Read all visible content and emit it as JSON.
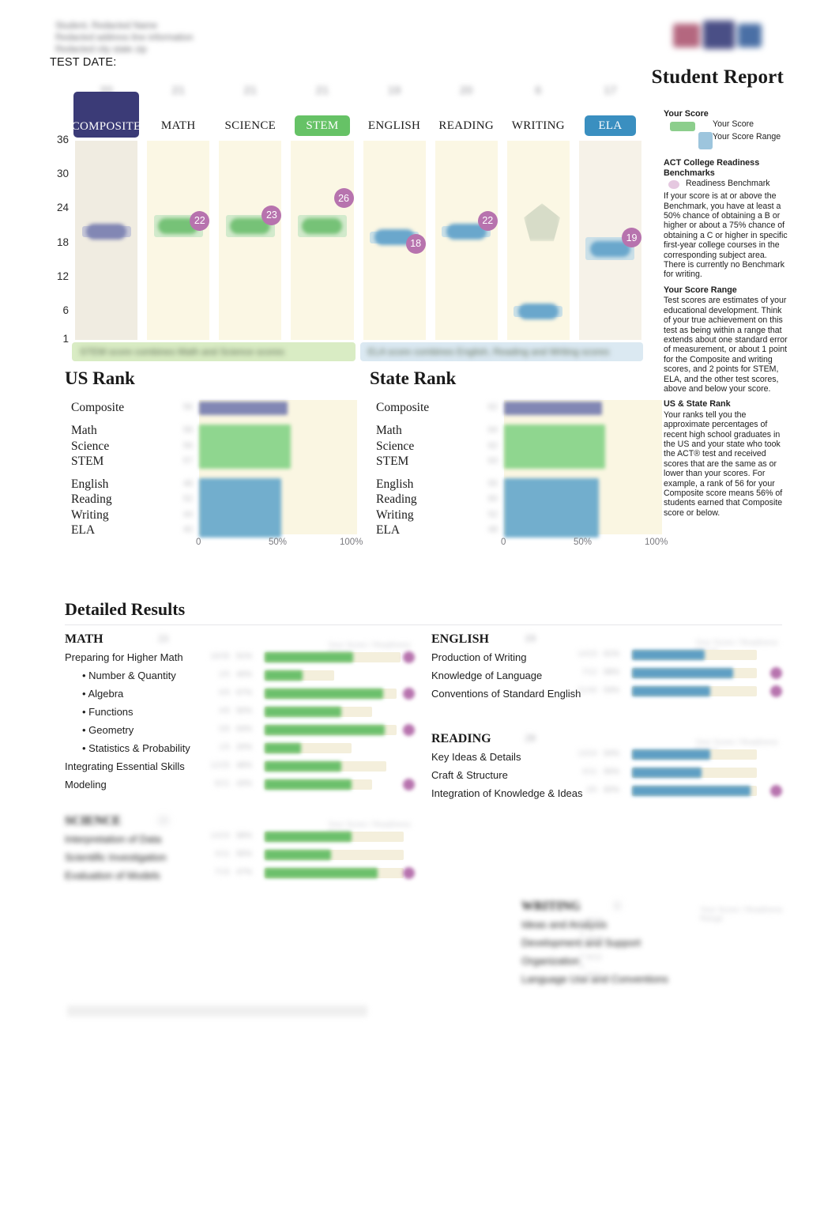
{
  "header": {
    "student_lines": [
      "Student, Redacted Name",
      "Redacted address line information",
      "Redacted city state zip"
    ],
    "test_date_label": "TEST DATE:",
    "test_date_value": "",
    "logo_alt": "ACT",
    "title": "Student Report"
  },
  "score_chart": {
    "y_ticks": [
      "36",
      "30",
      "24",
      "18",
      "12",
      "6",
      "1"
    ],
    "y_min": 1,
    "y_max": 36,
    "subjects": [
      {
        "key": "composite",
        "label": "COMPOSITE",
        "score_text": "20",
        "score": 20,
        "range_low": 19,
        "range_high": 21,
        "benchmark": null,
        "tab_style": "navy",
        "bar_color": "#8287b4",
        "band_color": "#f0ece1"
      },
      {
        "key": "math",
        "label": "MATH",
        "score_text": "21",
        "score": 21,
        "range_low": 19,
        "range_high": 23,
        "benchmark": 22,
        "tab_style": "plain",
        "bar_color": "#76c277",
        "band_color": "#fbf7e4"
      },
      {
        "key": "science",
        "label": "SCIENCE",
        "score_text": "21",
        "score": 21,
        "range_low": 19,
        "range_high": 23,
        "benchmark": 23,
        "tab_style": "plain",
        "bar_color": "#76c277",
        "band_color": "#fbf7e4"
      },
      {
        "key": "stem",
        "label": "STEM",
        "score_text": "21",
        "score": 21,
        "range_low": 19,
        "range_high": 23,
        "benchmark": 26,
        "tab_style": "green",
        "bar_color": "#76c277",
        "band_color": "#fbf7e4"
      },
      {
        "key": "english",
        "label": "ENGLISH",
        "score_text": "19",
        "score": 19,
        "range_low": 18,
        "range_high": 20,
        "benchmark": 18,
        "tab_style": "plain",
        "bar_color": "#6aa7cc",
        "band_color": "#fbf7e4"
      },
      {
        "key": "reading",
        "label": "READING",
        "score_text": "20",
        "score": 20,
        "range_low": 19,
        "range_high": 21,
        "benchmark": 22,
        "tab_style": "plain",
        "bar_color": "#6aa7cc",
        "band_color": "#fbf7e4"
      },
      {
        "key": "writing",
        "label": "WRITING",
        "score_text": "6",
        "score": 6,
        "range_low": 5,
        "range_high": 7,
        "benchmark": null,
        "tab_style": "plain",
        "bar_color": "#6aa7cc",
        "band_color": "#fbf7e4"
      },
      {
        "key": "ela",
        "label": "ELA",
        "score_text": "17",
        "score": 17,
        "range_low": 15,
        "range_high": 19,
        "benchmark": 19,
        "tab_style": "blue",
        "bar_color": "#6aa7cc",
        "band_color": "#f6f2e8"
      }
    ],
    "foot_bands": [
      {
        "key": "stem-band",
        "text": "STEM score combines Math and Science scores",
        "color": "#d9ecc4"
      },
      {
        "key": "ela-band",
        "text": "ELA score combines English, Reading and Writing scores",
        "color": "#dbe9f2"
      }
    ]
  },
  "legend": {
    "your_score_heading": "Your Score",
    "your_score_label": "Your Score",
    "your_score_range_label": "Your Score Range",
    "benchmark_heading": "ACT College Readiness Benchmarks",
    "benchmark_swatch_label": "Readiness Benchmark",
    "benchmark_body": "If your score is at or above the Benchmark, you have at least a 50% chance of obtaining a B or higher or about a 75% chance of obtaining a C or higher in specific first-year college courses in the corresponding subject area. There is currently no Benchmark for writing.",
    "range_heading": "Your Score Range",
    "range_body": "Test scores are estimates of your educational development. Think of your true achievement on this test as being within a range that extends about one standard error of measurement, or about 1 point for the Composite and writing scores, and 2 points for STEM, ELA, and the other test scores, above and below your score.",
    "rank_heading": "US & State Rank",
    "rank_body": "Your ranks tell you the approximate percentages of recent high school graduates in the US and your state who took the ACT® test and received scores that are the same as or lower than your scores. For example, a rank of 56 for your Composite score means 56% of students earned that Composite score or below."
  },
  "us_rank": {
    "title": "US Rank",
    "axis": [
      "0",
      "50%",
      "100%"
    ],
    "groups": [
      {
        "labels": [
          "Composite"
        ],
        "values": [
          "56"
        ],
        "bar_pct": 56,
        "color": "#8287b4",
        "type": "composite"
      },
      {
        "labels": [
          "Math",
          "Science",
          "STEM"
        ],
        "values": [
          "58",
          "56",
          "57"
        ],
        "bar_pct": 58,
        "color": "#8fd68f",
        "type": "stem"
      },
      {
        "labels": [
          "English",
          "Reading",
          "Writing",
          "ELA"
        ],
        "values": [
          "48",
          "52",
          "44",
          "40"
        ],
        "bar_pct": 52,
        "color": "#72aecd",
        "type": "ela"
      }
    ]
  },
  "state_rank": {
    "title": "State Rank",
    "axis": [
      "0",
      "50%",
      "100%"
    ],
    "groups": [
      {
        "labels": [
          "Composite"
        ],
        "values": [
          "62"
        ],
        "bar_pct": 62,
        "color": "#8287b4",
        "type": "composite"
      },
      {
        "labels": [
          "Math",
          "Science",
          "STEM"
        ],
        "values": [
          "64",
          "62",
          "63"
        ],
        "bar_pct": 64,
        "color": "#8fd68f",
        "type": "stem"
      },
      {
        "labels": [
          "English",
          "Reading",
          "Writing",
          "ELA"
        ],
        "values": [
          "55",
          "60",
          "52",
          "48"
        ],
        "bar_pct": 60,
        "color": "#72aecd",
        "type": "ela"
      }
    ]
  },
  "detailed_results": {
    "title": "Detailed Results",
    "column_header": "Your Score / Readiness Range",
    "sections": [
      {
        "key": "math",
        "heading": "MATH",
        "score": "21",
        "color": "#6cc06c",
        "rows": [
          {
            "label": "Preparing for Higher Math",
            "indent": false,
            "correct": "18/35",
            "pct": "51%",
            "fill": 51,
            "track": 78,
            "bench": true
          },
          {
            "label": "Number & Quantity",
            "indent": true,
            "correct": "2/5",
            "pct": "40%",
            "fill": 22,
            "track": 40,
            "bench": false
          },
          {
            "label": "Algebra",
            "indent": true,
            "correct": "6/9",
            "pct": "67%",
            "fill": 68,
            "track": 76,
            "bench": true
          },
          {
            "label": "Functions",
            "indent": true,
            "correct": "4/8",
            "pct": "50%",
            "fill": 44,
            "track": 62,
            "bench": false
          },
          {
            "label": "Geometry",
            "indent": true,
            "correct": "5/8",
            "pct": "63%",
            "fill": 69,
            "track": 76,
            "bench": true
          },
          {
            "label": "Statistics & Probability",
            "indent": true,
            "correct": "1/5",
            "pct": "20%",
            "fill": 21,
            "track": 50,
            "bench": false
          },
          {
            "label": "Integrating Essential Skills",
            "indent": false,
            "correct": "12/25",
            "pct": "48%",
            "fill": 44,
            "track": 70,
            "bench": false
          },
          {
            "label": "Modeling",
            "indent": false,
            "correct": "9/21",
            "pct": "43%",
            "fill": 50,
            "track": 62,
            "bench": true
          }
        ]
      },
      {
        "key": "science",
        "heading": "SCIENCE",
        "score": "21",
        "color": "#6cc06c",
        "rows": [
          {
            "label": "Interpretation of Data",
            "indent": false,
            "correct": "14/24",
            "pct": "58%",
            "fill": 50,
            "track": 80,
            "bench": false
          },
          {
            "label": "Scientific Investigation",
            "indent": false,
            "correct": "6/11",
            "pct": "55%",
            "fill": 38,
            "track": 80,
            "bench": false
          },
          {
            "label": "Evaluation of Models",
            "indent": false,
            "correct": "7/15",
            "pct": "47%",
            "fill": 65,
            "track": 80,
            "bench": true
          }
        ]
      },
      {
        "key": "english",
        "heading": "ENGLISH",
        "score": "19",
        "color": "#5f9fc4",
        "rows": [
          {
            "label": "Production of Writing",
            "indent": false,
            "correct": "14/23",
            "pct": "61%",
            "fill": 42,
            "track": 72,
            "bench": false
          },
          {
            "label": "Knowledge of Language",
            "indent": false,
            "correct": "7/12",
            "pct": "58%",
            "fill": 58,
            "track": 72,
            "bench": true
          },
          {
            "label": "Conventions of Standard English",
            "indent": false,
            "correct": "21/40",
            "pct": "53%",
            "fill": 45,
            "track": 72,
            "bench": true
          }
        ]
      },
      {
        "key": "reading",
        "heading": "READING",
        "score": "20",
        "color": "#5f9fc4",
        "rows": [
          {
            "label": "Key Ideas & Details",
            "indent": false,
            "correct": "13/24",
            "pct": "54%",
            "fill": 45,
            "track": 72,
            "bench": false
          },
          {
            "label": "Craft & Structure",
            "indent": false,
            "correct": "6/11",
            "pct": "55%",
            "fill": 40,
            "track": 72,
            "bench": false
          },
          {
            "label": "Integration of Knowledge & Ideas",
            "indent": false,
            "correct": "3/5",
            "pct": "60%",
            "fill": 68,
            "track": 72,
            "bench": true
          }
        ]
      },
      {
        "key": "writing",
        "heading": "WRITING",
        "score": "6",
        "color": "#5f9fc4",
        "rows": [
          {
            "label": "Ideas and Analysis",
            "indent": false,
            "correct": "6/12",
            "pct": "",
            "fill": 0,
            "track": 0,
            "bench": false
          },
          {
            "label": "Development and Support",
            "indent": false,
            "correct": "6/12",
            "pct": "",
            "fill": 0,
            "track": 0,
            "bench": false
          },
          {
            "label": "Organization",
            "indent": false,
            "correct": "6/12",
            "pct": "",
            "fill": 0,
            "track": 0,
            "bench": false
          },
          {
            "label": "Language Use and Conventions",
            "indent": false,
            "correct": "6/12",
            "pct": "",
            "fill": 0,
            "track": 0,
            "bench": false
          }
        ]
      }
    ]
  },
  "footer": {
    "note": "Redacted footer disclaimer text about score reporting."
  },
  "colors": {
    "composite_navy": "#3b3b77",
    "stem_green": "#66c266",
    "ela_blue": "#3a8fc0",
    "benchmark_purple": "#b773ae",
    "band_cream": "#faf6e2",
    "score_green": "#76c277",
    "score_blue": "#6aa7cc"
  }
}
